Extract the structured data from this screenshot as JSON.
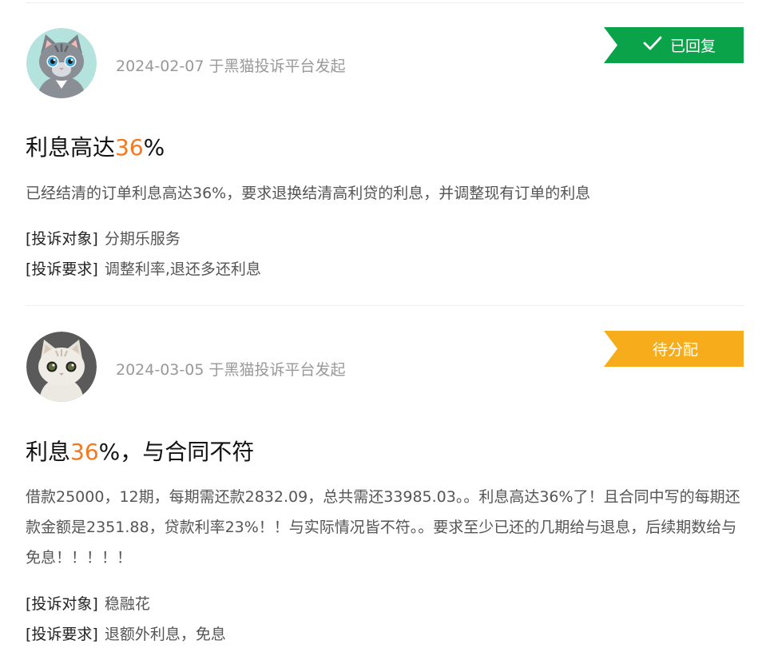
{
  "complaints": [
    {
      "date": "2024-02-07",
      "source": "于黑猫投诉平台发起",
      "status": "已回复",
      "status_color": "#0aa34a",
      "status_icon": "check-icon",
      "title_before": "利息高达",
      "title_highlight": "36",
      "title_after": "%",
      "description": "已经结清的订单利息高达36%，要求退换结清高利贷的利息，并调整现有订单的利息",
      "target_label": "[投诉对象]",
      "target": "分期乐服务",
      "demand_label": "[投诉要求]",
      "demand": "调整利率,退还多还利息"
    },
    {
      "date": "2024-03-05",
      "source": "于黑猫投诉平台发起",
      "status": "待分配",
      "status_color": "#f7ac1b",
      "title_before": "利息",
      "title_highlight": "36",
      "title_after": "%，与合同不符",
      "description": "借款25000，12期，每期需还款2832.09，总共需还33985.03。。利息高达36%了！且合同中写的每期还款金额是2351.88，贷款利率23%！！与实际情况皆不符。。要求至少已还的几期给与退息，后续期数给与免息！！！！！",
      "target_label": "[投诉对象]",
      "target": "稳融花",
      "demand_label": "[投诉要求]",
      "demand": "退额外利息，免息"
    }
  ],
  "highlight_color": "#f5781f"
}
